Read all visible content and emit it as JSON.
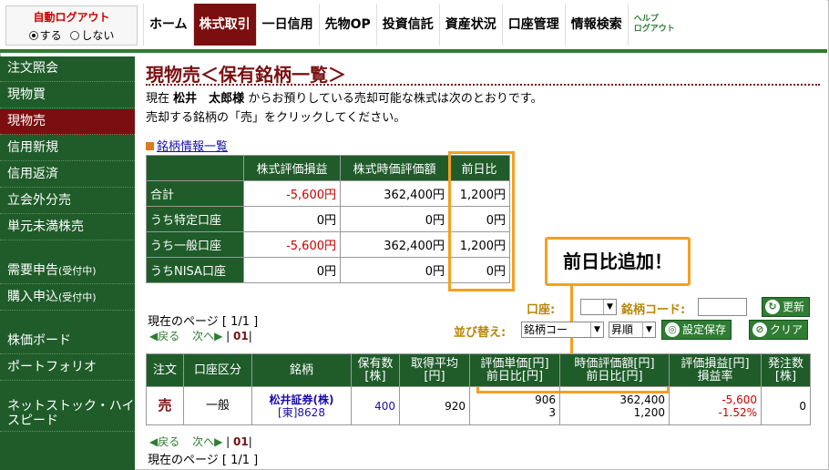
{
  "autologout": {
    "title": "自動ログアウト",
    "on": "する",
    "off": "しない"
  },
  "nav": [
    "ホーム",
    "株式取引",
    "一日信用",
    "先物OP",
    "投資信託",
    "資産状況",
    "口座管理",
    "情報検索"
  ],
  "help": {
    "line1": "ヘルプ",
    "line2": "ログアウト"
  },
  "sidebar": [
    {
      "label": "注文照会"
    },
    {
      "label": "現物買"
    },
    {
      "label": "現物売"
    },
    {
      "label": "信用新規"
    },
    {
      "label": "信用返済"
    },
    {
      "label": "立会外分売"
    },
    {
      "label": "単元未満株売"
    },
    {
      "label": "需要申告",
      "small": "(受付中)"
    },
    {
      "label": "購入申込",
      "small": "(受付中)"
    },
    {
      "label": "株価ボード"
    },
    {
      "label": "ポートフォリオ"
    },
    {
      "label": "ネットストック・ハイスピード"
    }
  ],
  "page": {
    "title": "現物売＜保有銘柄一覧＞",
    "intro1_pre": "現在",
    "user": "松井　太郎様",
    "intro1_post": "からお預りしている売却可能な株式は次のとおりです。",
    "intro2": "売却する銘柄の「売」をクリックしてください。",
    "info_link": "銘柄情報一覧"
  },
  "summary": {
    "headers": [
      "株式評価損益",
      "株式時価評価額",
      "前日比"
    ],
    "rows": [
      {
        "label": "合計",
        "pl": "-5,600円",
        "value": "362,400円",
        "change": "1,200円"
      },
      {
        "label": "うち特定口座",
        "pl": "0円",
        "value": "0円",
        "change": "0円"
      },
      {
        "label": "うち一般口座",
        "pl": "-5,600円",
        "value": "362,400円",
        "change": "1,200円"
      },
      {
        "label": "うちNISA口座",
        "pl": "0円",
        "value": "0円",
        "change": "0円"
      }
    ]
  },
  "callout": "前日比追加！",
  "controls": {
    "account_label": "口座:",
    "code_label": "銘柄コード:",
    "update": "更新",
    "sort_label": "並び替え:",
    "sort_field": "銘柄コー",
    "sort_order": "昇順",
    "save": "設定保存",
    "clear": "クリア"
  },
  "pagination": {
    "page_info": "現在のページ [ 1/1 ]",
    "prev": "◀戻る",
    "next": "次へ▶",
    "current": "01"
  },
  "holdings": {
    "headers": [
      "注文",
      "口座区分",
      "銘柄",
      "保有数\n[株]",
      "取得平均\n[円]",
      "評価単価[円]\n前日比[円]",
      "時価評価額[円]\n前日比[円]",
      "評価損益[円]\n損益率",
      "発注数\n[株]"
    ],
    "rows": [
      {
        "order": "売",
        "account": "一般",
        "name": "松井証券(株)",
        "code": "[東]8628",
        "qty": "400",
        "avg": "920",
        "price": "906",
        "price_change": "3",
        "value": "362,400",
        "value_change": "1,200",
        "pl": "-5,600",
        "pl_rate": "-1.52%",
        "ordered": "0"
      }
    ]
  },
  "colors": {
    "brand_green": "#1f5c2a",
    "accent_red": "#7b0f0f",
    "highlight": "#f4a020"
  }
}
